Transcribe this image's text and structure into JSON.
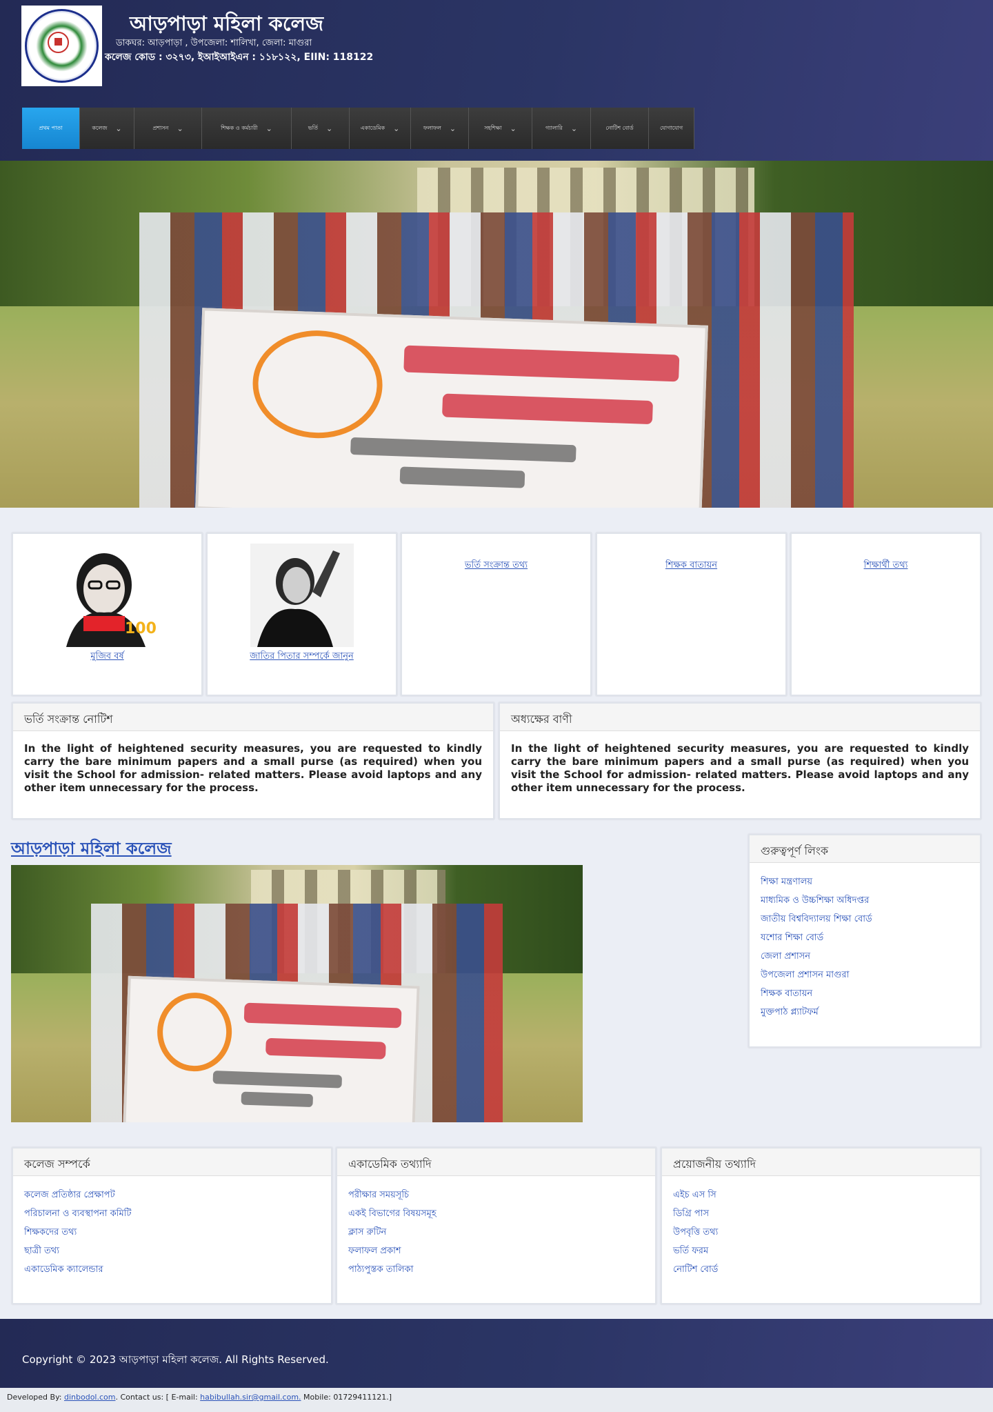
{
  "header": {
    "title": "আড়পাড়া মহিলা কলেজ",
    "address": "ডাকঘর: আড়পাড়া , উপজেলা: শালিখা, জেলা: মাগুরা",
    "codes": "কলেজ কোড : ৩২৭৩, ইআইআইএন : ১১৮১২২, EIIN: 118122",
    "logo_alt": "আড়পাড়া মহিলা কলেজ লোগো"
  },
  "nav": {
    "items": [
      {
        "label": "প্রথম পাতা",
        "active": true,
        "dropdown": false
      },
      {
        "label": "কলেজ",
        "active": false,
        "dropdown": true
      },
      {
        "label": "প্রশাসন",
        "active": false,
        "dropdown": true
      },
      {
        "label": "শিক্ষক ও কর্মচারী",
        "active": false,
        "dropdown": true
      },
      {
        "label": "ভর্তি",
        "active": false,
        "dropdown": true
      },
      {
        "label": "একাডেমিক",
        "active": false,
        "dropdown": true
      },
      {
        "label": "ফলাফল",
        "active": false,
        "dropdown": true
      },
      {
        "label": "সহশিক্ষা",
        "active": false,
        "dropdown": true
      },
      {
        "label": "গ্যালারি",
        "active": false,
        "dropdown": true
      },
      {
        "label": "নোটিশ বোর্ড",
        "active": false,
        "dropdown": false
      },
      {
        "label": "যোগাযোগ",
        "active": false,
        "dropdown": false
      }
    ]
  },
  "cards": [
    {
      "label": "মুজিব বর্ষ"
    },
    {
      "label": "জাতির পিতার সম্পর্কে জানুন"
    },
    {
      "label": "ভর্তি সংক্রান্ত তথ্য"
    },
    {
      "label": "শিক্ষক বাতায়ন"
    },
    {
      "label": "শিক্ষার্থী তথ্য"
    }
  ],
  "notices": [
    {
      "title": "ভর্তি সংক্রান্ত নোটিশ",
      "body": "In the light of heightened security measures, you are requested to kindly carry the bare minimum papers and a small purse (as required) when you visit the School for admission- related matters. Please avoid laptops and any other item unnecessary for the process."
    },
    {
      "title": "অধ্যক্ষের বাণী",
      "body": "In the light of heightened security measures, you are requested to kindly carry the bare minimum papers and a small purse (as required) when you visit the School for admission- related matters. Please avoid laptops and any other item unnecessary for the process."
    }
  ],
  "about": {
    "title": "আড়পাড়া মহিলা কলেজ"
  },
  "important_links": {
    "title": "গুরুত্বপূর্ণ লিংক",
    "items": [
      "শিক্ষা মন্ত্রণালয়",
      "মাধ্যমিক ও উচ্চশিক্ষা অধিদপ্তর",
      "জাতীয় বিশ্ববিদ্যালয় শিক্ষা বোর্ড",
      "যশোর শিক্ষা বোর্ড",
      "জেলা প্রশাসন",
      "উপজেলা প্রশাসন মাগুরা",
      "শিক্ষক বাতায়ন",
      "মুক্তপাঠ প্ল্যাটফর্ম"
    ]
  },
  "footer_columns": [
    {
      "title": "কলেজ সম্পর্কে",
      "items": [
        "কলেজ প্রতিষ্ঠার প্রেক্ষাপট",
        "পরিচালনা ও ব্যবস্থাপনা কমিটি",
        "শিক্ষকদের তথ্য",
        "ছাত্রী তথ্য",
        "একাডেমিক ক্যালেন্ডার"
      ]
    },
    {
      "title": "একাডেমিক তথ্যাদি",
      "items": [
        "পরীক্ষার সময়সূচি",
        "একই বিভাগের বিষয়সমূহ",
        "ক্লাস রুটিন",
        "ফলাফল প্রকাশ",
        "পাঠ্যপুস্তক তালিকা"
      ]
    },
    {
      "title": "প্রয়োজনীয় তথ্যাদি",
      "items": [
        "এইচ এস সি",
        "ডিগ্রি পাস",
        "উপবৃত্তি তথ্য",
        "ভর্তি ফরম",
        "নোটিশ বোর্ড"
      ]
    }
  ],
  "footer": {
    "copyright": "Copyright © 2023 আড়পাড়া মহিলা কলেজ. All Rights Reserved."
  },
  "developer": {
    "prefix": "Developed By: ",
    "site": "dinbodol.com",
    "contact_prefix": ". Contact us: [ E-mail: ",
    "email": "habibullah.sir@gmail.com.",
    "mobile": " Mobile: 01729411121.]"
  }
}
